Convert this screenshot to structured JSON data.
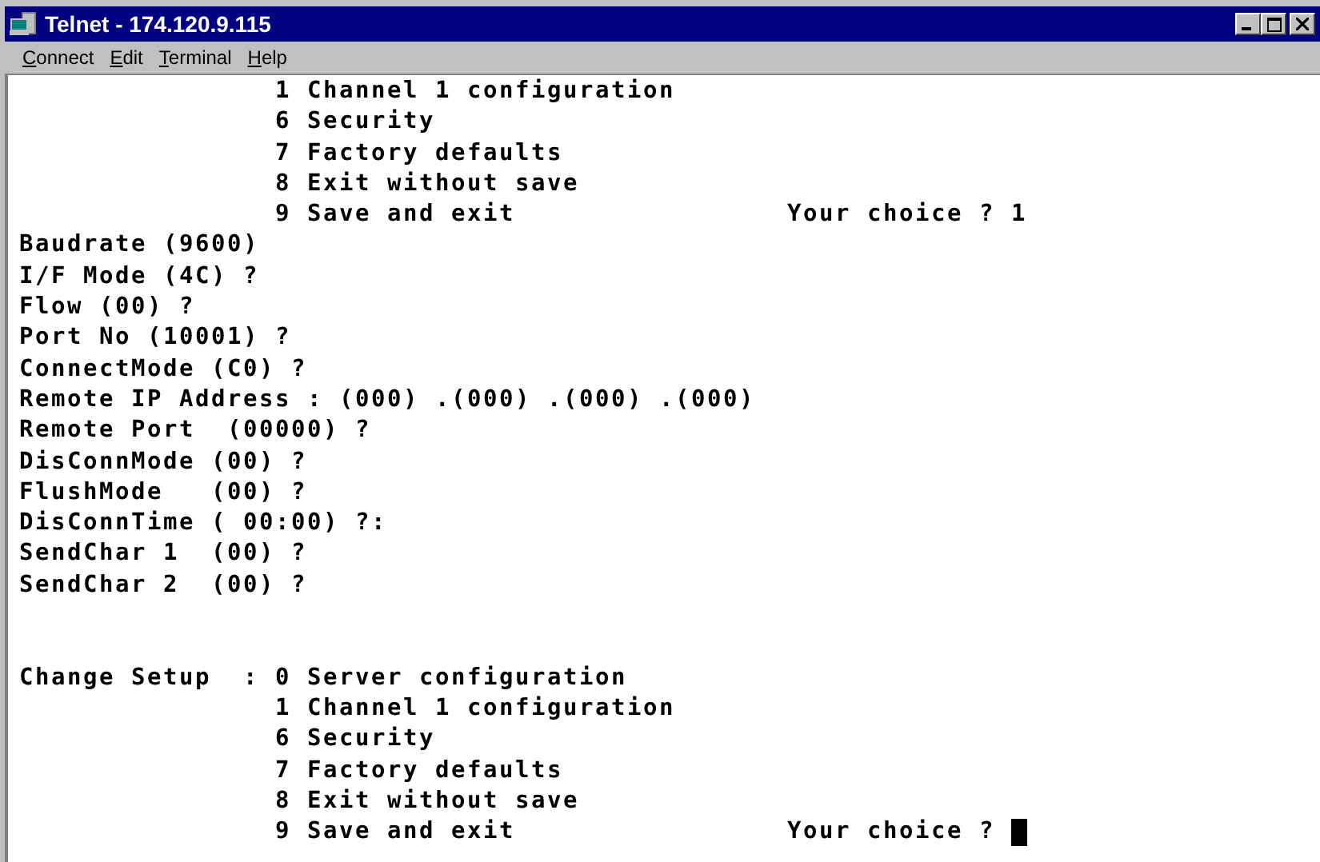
{
  "window": {
    "title": "Telnet - 174.120.9.115"
  },
  "menu": [
    "Connect",
    "Edit",
    "Terminal",
    "Help"
  ],
  "terminal": {
    "previous_menu": {
      "options": [
        "1 Channel 1 configuration",
        "6 Security",
        "7 Factory defaults",
        "8 Exit without save",
        "9 Save and exit"
      ],
      "prompt": "Your choice ? 1"
    },
    "settings": [
      "Baudrate (9600)",
      "I/F Mode (4C) ?",
      "Flow (00) ?",
      "Port No (10001) ?",
      "ConnectMode (C0) ?",
      "Remote IP Address : (000) .(000) .(000) .(000)",
      "Remote Port  (00000) ?",
      "DisConnMode (00) ?",
      "FlushMode   (00) ?",
      "DisConnTime ( 00:00) ?:",
      "SendChar 1  (00) ?",
      "SendChar 2  (00) ?"
    ],
    "change_setup": {
      "label": "Change Setup  :",
      "options": [
        "0 Server configuration",
        "1 Channel 1 configuration",
        "6 Security",
        "7 Factory defaults",
        "8 Exit without save",
        "9 Save and exit"
      ],
      "prompt": "Your choice ?",
      "cursor": true
    }
  }
}
